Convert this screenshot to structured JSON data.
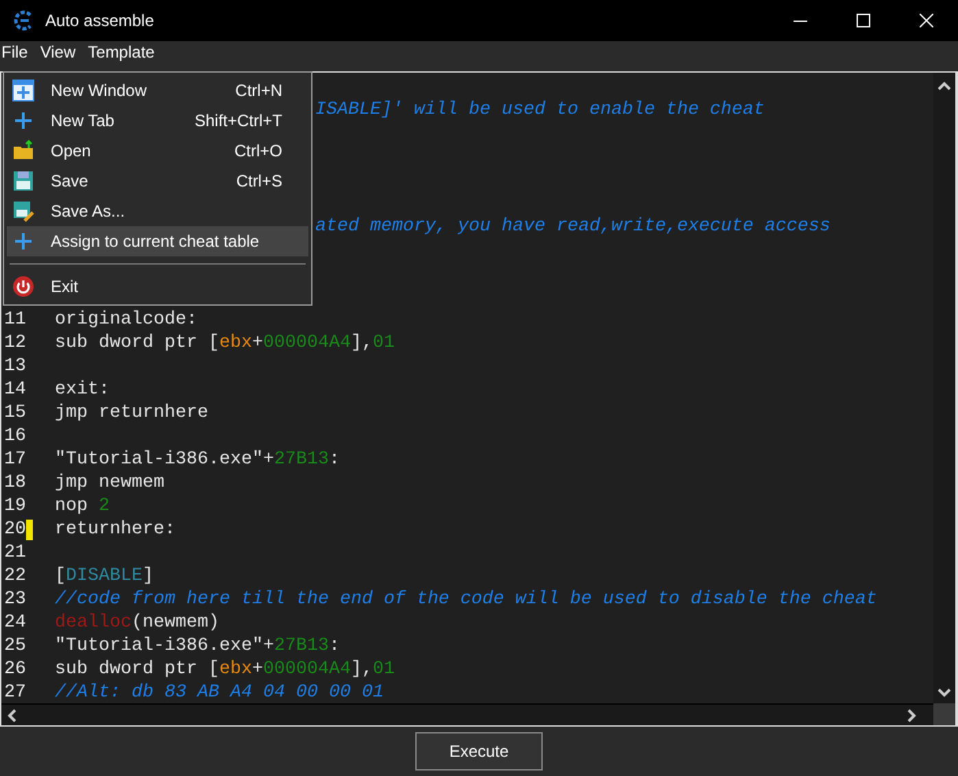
{
  "window": {
    "title": "Auto assemble"
  },
  "menubar": [
    "File",
    "View",
    "Template"
  ],
  "file_menu": [
    {
      "kind": "item",
      "label": "New Window",
      "shortcut": "Ctrl+N",
      "selected": false
    },
    {
      "kind": "item",
      "label": "New Tab",
      "shortcut": "Shift+Ctrl+T",
      "selected": false
    },
    {
      "kind": "item",
      "label": "Open",
      "shortcut": "Ctrl+O",
      "selected": false
    },
    {
      "kind": "item",
      "label": "Save",
      "shortcut": "Ctrl+S",
      "selected": false
    },
    {
      "kind": "item",
      "label": "Save As...",
      "selected": false
    },
    {
      "kind": "item",
      "label": "Assign to current cheat table",
      "selected": true
    },
    {
      "kind": "separator"
    },
    {
      "kind": "item",
      "label": "Exit",
      "selected": false
    }
  ],
  "editor": {
    "lines": [
      {
        "kind": "hidden"
      },
      {
        "kind": "partial",
        "tokens": [
          {
            "text": "ISABLE]' will be used to enable the cheat",
            "kind": "comment"
          }
        ]
      },
      {
        "kind": "hidden"
      },
      {
        "kind": "hidden"
      },
      {
        "kind": "hidden"
      },
      {
        "kind": "hidden"
      },
      {
        "kind": "partial",
        "tokens": [
          {
            "text": "ated memory, you have read,write,execute access",
            "kind": "comment"
          }
        ]
      },
      {
        "kind": "hidden"
      },
      {
        "kind": "hidden"
      },
      {
        "kind": "hidden"
      },
      {
        "kind": "code",
        "number": "11",
        "marked": false,
        "tokens": [
          {
            "text": "originalcode:",
            "kind": "plain"
          }
        ]
      },
      {
        "kind": "code",
        "number": "12",
        "marked": false,
        "tokens": [
          {
            "text": "sub dword ptr [",
            "kind": "plain"
          },
          {
            "text": "ebx",
            "kind": "register"
          },
          {
            "text": "+",
            "kind": "plain"
          },
          {
            "text": "000004A4",
            "kind": "number"
          },
          {
            "text": "],",
            "kind": "plain"
          },
          {
            "text": "01",
            "kind": "number"
          }
        ]
      },
      {
        "kind": "code",
        "number": "13",
        "marked": false
      },
      {
        "kind": "code",
        "number": "14",
        "marked": false,
        "tokens": [
          {
            "text": "exit:",
            "kind": "plain"
          }
        ]
      },
      {
        "kind": "code",
        "number": "15",
        "marked": false,
        "tokens": [
          {
            "text": "jmp returnhere",
            "kind": "plain"
          }
        ]
      },
      {
        "kind": "code",
        "number": "16",
        "marked": false
      },
      {
        "kind": "code",
        "number": "17",
        "marked": false,
        "tokens": [
          {
            "text": "\"Tutorial-i386.exe\"+",
            "kind": "plain"
          },
          {
            "text": "27B13",
            "kind": "number"
          },
          {
            "text": ":",
            "kind": "plain"
          }
        ]
      },
      {
        "kind": "code",
        "number": "18",
        "marked": false,
        "tokens": [
          {
            "text": "jmp newmem",
            "kind": "plain"
          }
        ]
      },
      {
        "kind": "code",
        "number": "19",
        "marked": false,
        "tokens": [
          {
            "text": "nop ",
            "kind": "plain"
          },
          {
            "text": "2",
            "kind": "number"
          }
        ]
      },
      {
        "kind": "code",
        "number": "20",
        "marked": true,
        "tokens": [
          {
            "text": "returnhere:",
            "kind": "plain"
          }
        ]
      },
      {
        "kind": "code",
        "number": "21",
        "marked": false
      },
      {
        "kind": "code",
        "number": "22",
        "marked": false,
        "tokens": [
          {
            "text": "[",
            "kind": "plain"
          },
          {
            "text": "DISABLE",
            "kind": "section"
          },
          {
            "text": "]",
            "kind": "plain"
          }
        ]
      },
      {
        "kind": "code",
        "number": "23",
        "marked": false,
        "tokens": [
          {
            "text": "//code from here till the end of the code will be used to disable the cheat",
            "kind": "comment"
          }
        ]
      },
      {
        "kind": "code",
        "number": "24",
        "marked": false,
        "tokens": [
          {
            "text": "dealloc",
            "kind": "keyword"
          },
          {
            "text": "(newmem)",
            "kind": "plain"
          }
        ]
      },
      {
        "kind": "code",
        "number": "25",
        "marked": false,
        "tokens": [
          {
            "text": "\"Tutorial-i386.exe\"+",
            "kind": "plain"
          },
          {
            "text": "27B13",
            "kind": "number"
          },
          {
            "text": ":",
            "kind": "plain"
          }
        ]
      },
      {
        "kind": "code",
        "number": "26",
        "marked": false,
        "tokens": [
          {
            "text": "sub dword ptr [",
            "kind": "plain"
          },
          {
            "text": "ebx",
            "kind": "register"
          },
          {
            "text": "+",
            "kind": "plain"
          },
          {
            "text": "000004A4",
            "kind": "number"
          },
          {
            "text": "],",
            "kind": "plain"
          },
          {
            "text": "01",
            "kind": "number"
          }
        ]
      },
      {
        "kind": "code",
        "number": "27",
        "marked": false,
        "tokens": [
          {
            "text": "//Alt: db 83 AB A4 04 00 00 01",
            "kind": "comment"
          }
        ]
      }
    ]
  },
  "execute_button": "Execute"
}
